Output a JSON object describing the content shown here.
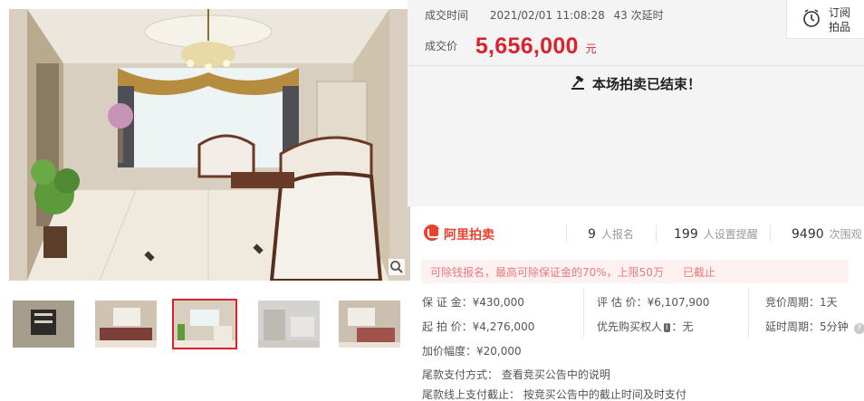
{
  "deal": {
    "time_label": "成交时间",
    "time_value": "2021/02/01 11:08:28",
    "delay_count": "43 次延时",
    "price_label": "成交价",
    "price_value": "5,656,000",
    "price_unit": "元",
    "ended_text": "本场拍卖已结束！"
  },
  "subscribe": {
    "line1": "订阅",
    "line2": "拍品"
  },
  "stats": {
    "logo_text": "阿里拍卖",
    "signups_num": "9",
    "signups_label": "人报名",
    "reminders_num": "199",
    "reminders_label": "人设置提醒",
    "views_num": "9490",
    "views_label": "次围观"
  },
  "notice": {
    "text": "可除钱报名，最高可除保证金的70%，上限50万",
    "status": "已截止"
  },
  "details": {
    "deposit": "保 证 金：¥430,000",
    "appraisal": "评 估 价：¥6,107,900",
    "cycle": "竞价周期：1天",
    "start_price": "起 拍 价：¥4,276,000",
    "priority_label": "优先购买权人",
    "priority_tag": "i",
    "priority_value": "：无",
    "delay_cycle": "延时周期：5分钟",
    "increment": "加价幅度：¥20,000",
    "payment_method": "尾款支付方式：  查看竞买公告中的说明",
    "payment_deadline": "尾款线上支付截止：  按竞买公告中的截止时间及时支付"
  },
  "gallery": {
    "thumb_count": 5,
    "active_index": 2
  },
  "colors": {
    "accent": "#d9232e",
    "brand": "#e8432e",
    "panel": "#f4f4f4"
  }
}
